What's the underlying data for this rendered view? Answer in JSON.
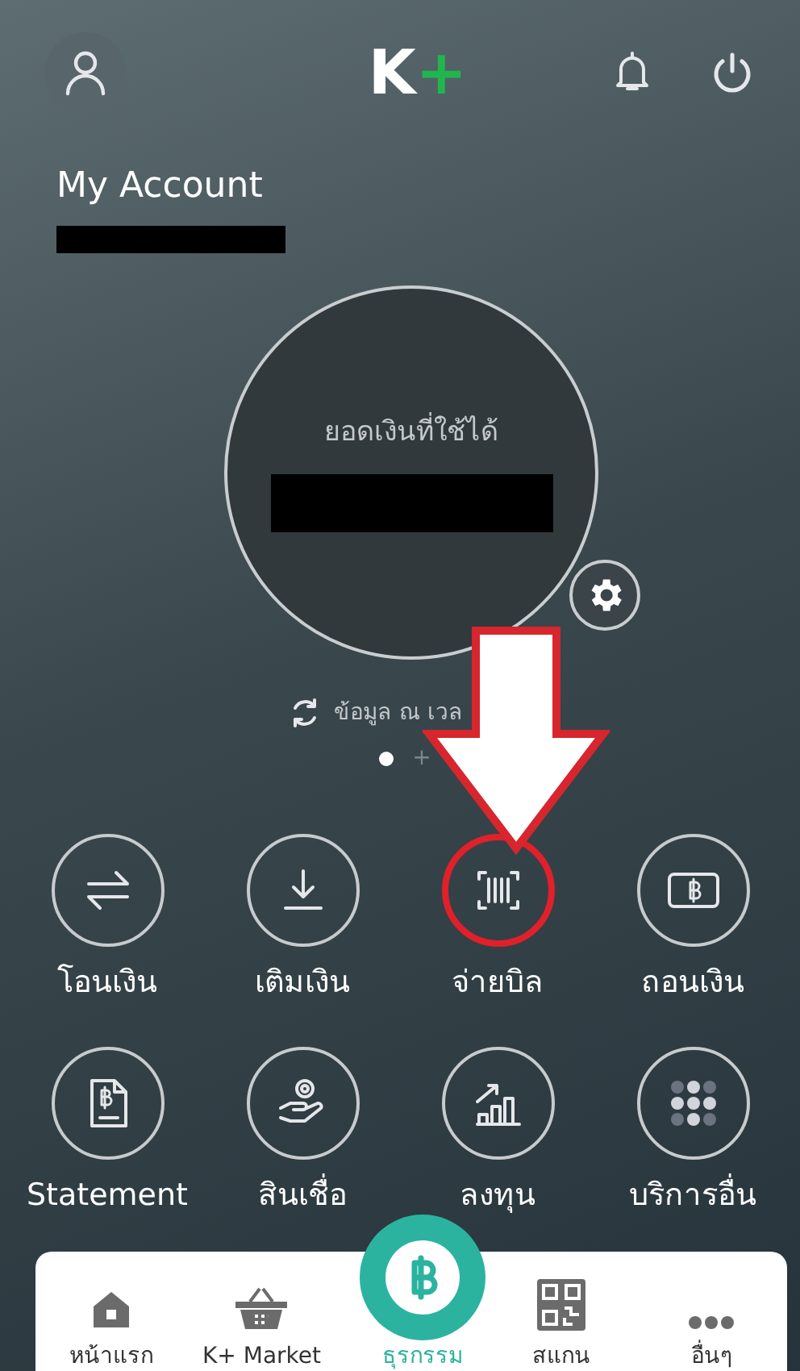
{
  "logo": {
    "letter": "K",
    "plus": "+"
  },
  "account": {
    "title": "My Account"
  },
  "balance": {
    "label": "ยอดเงินที่ใช้ได้"
  },
  "updated": {
    "text": "ข้อมูล ณ เวล"
  },
  "pager": [
    {
      "kind": "dot",
      "selected": true
    },
    {
      "kind": "add",
      "label": "+",
      "selected": false
    }
  ],
  "actions": [
    {
      "kind": "transfer",
      "label": "โอนเงิน",
      "highlighted": false
    },
    {
      "kind": "topup",
      "label": "เติมเงิน",
      "highlighted": false
    },
    {
      "kind": "bill",
      "label": "จ่ายบิล",
      "highlighted": true
    },
    {
      "kind": "withdraw",
      "label": "ถอนเงิน",
      "highlighted": false
    },
    {
      "kind": "statement",
      "label": "Statement",
      "highlighted": false
    },
    {
      "kind": "loan",
      "label": "สินเชื่อ",
      "highlighted": false
    },
    {
      "kind": "invest",
      "label": "ลงทุน",
      "highlighted": false
    },
    {
      "kind": "more",
      "label": "บริการอื่น",
      "highlighted": false
    }
  ],
  "nav": [
    {
      "kind": "home",
      "label": "หน้าแรก",
      "selected": false
    },
    {
      "kind": "market",
      "label": "K+ Market",
      "selected": false
    },
    {
      "kind": "transaction",
      "label": "ธุรกรรม",
      "selected": true
    },
    {
      "kind": "scan",
      "label": "สแกน",
      "selected": false
    },
    {
      "kind": "other",
      "label": "อื่นๆ",
      "selected": false
    }
  ]
}
